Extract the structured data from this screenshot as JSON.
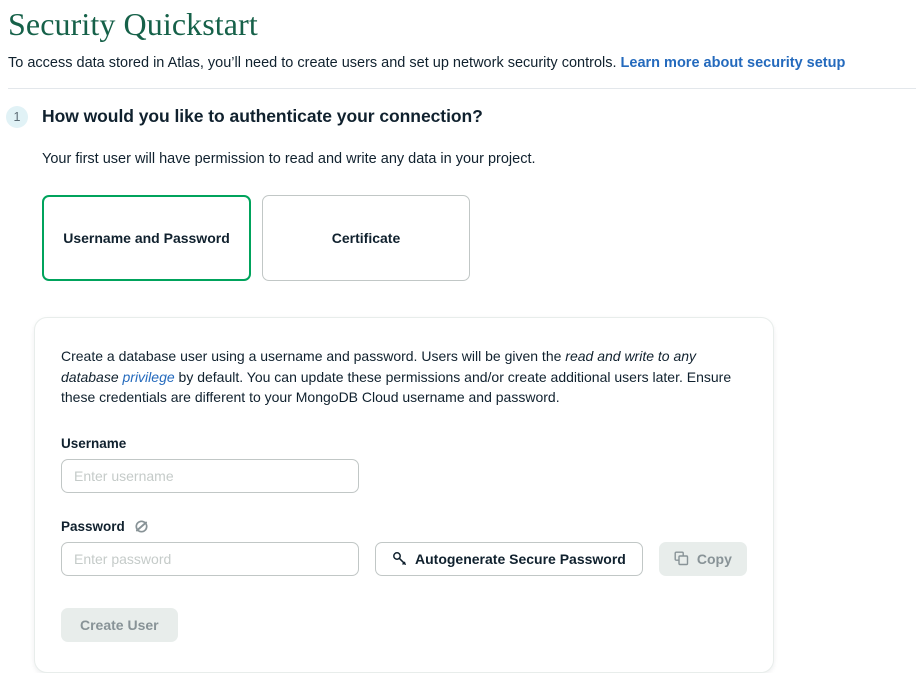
{
  "header": {
    "title": "Security Quickstart",
    "subtitle_text": "To access data stored in Atlas, you’ll need to create users and set up network security controls.",
    "subtitle_link": "Learn more about security setup",
    "title_color": "#166149",
    "link_color": "#246abd"
  },
  "step": {
    "number": "1",
    "heading": "How would you like to authenticate your connection?",
    "description": "Your first user will have permission to read and write any data in your project.",
    "badge_bg": "#e1f2f6"
  },
  "options": [
    {
      "label": "Username and Password",
      "selected": true
    },
    {
      "label": "Certificate",
      "selected": false
    }
  ],
  "selected_border_color": "#00a35c",
  "form": {
    "description": {
      "part1": "Create a database user using a username and password. Users will be given the ",
      "italic_part": "read and write to any database ",
      "link": "privilege",
      "part2": " by default. You can update these permissions and/or create additional users later. Ensure these credentials are different to your MongoDB Cloud username and password."
    },
    "username": {
      "label": "Username",
      "placeholder": "Enter username",
      "value": ""
    },
    "password": {
      "label": "Password",
      "placeholder": "Enter password",
      "value": "",
      "visibility_icon": "eye-off-icon"
    },
    "autogenerate_button": {
      "label": "Autogenerate Secure Password",
      "icon": "key-icon"
    },
    "copy_button": {
      "label": "Copy",
      "icon": "copy-icon",
      "disabled": true
    },
    "create_button": {
      "label": "Create User",
      "disabled": true
    }
  }
}
